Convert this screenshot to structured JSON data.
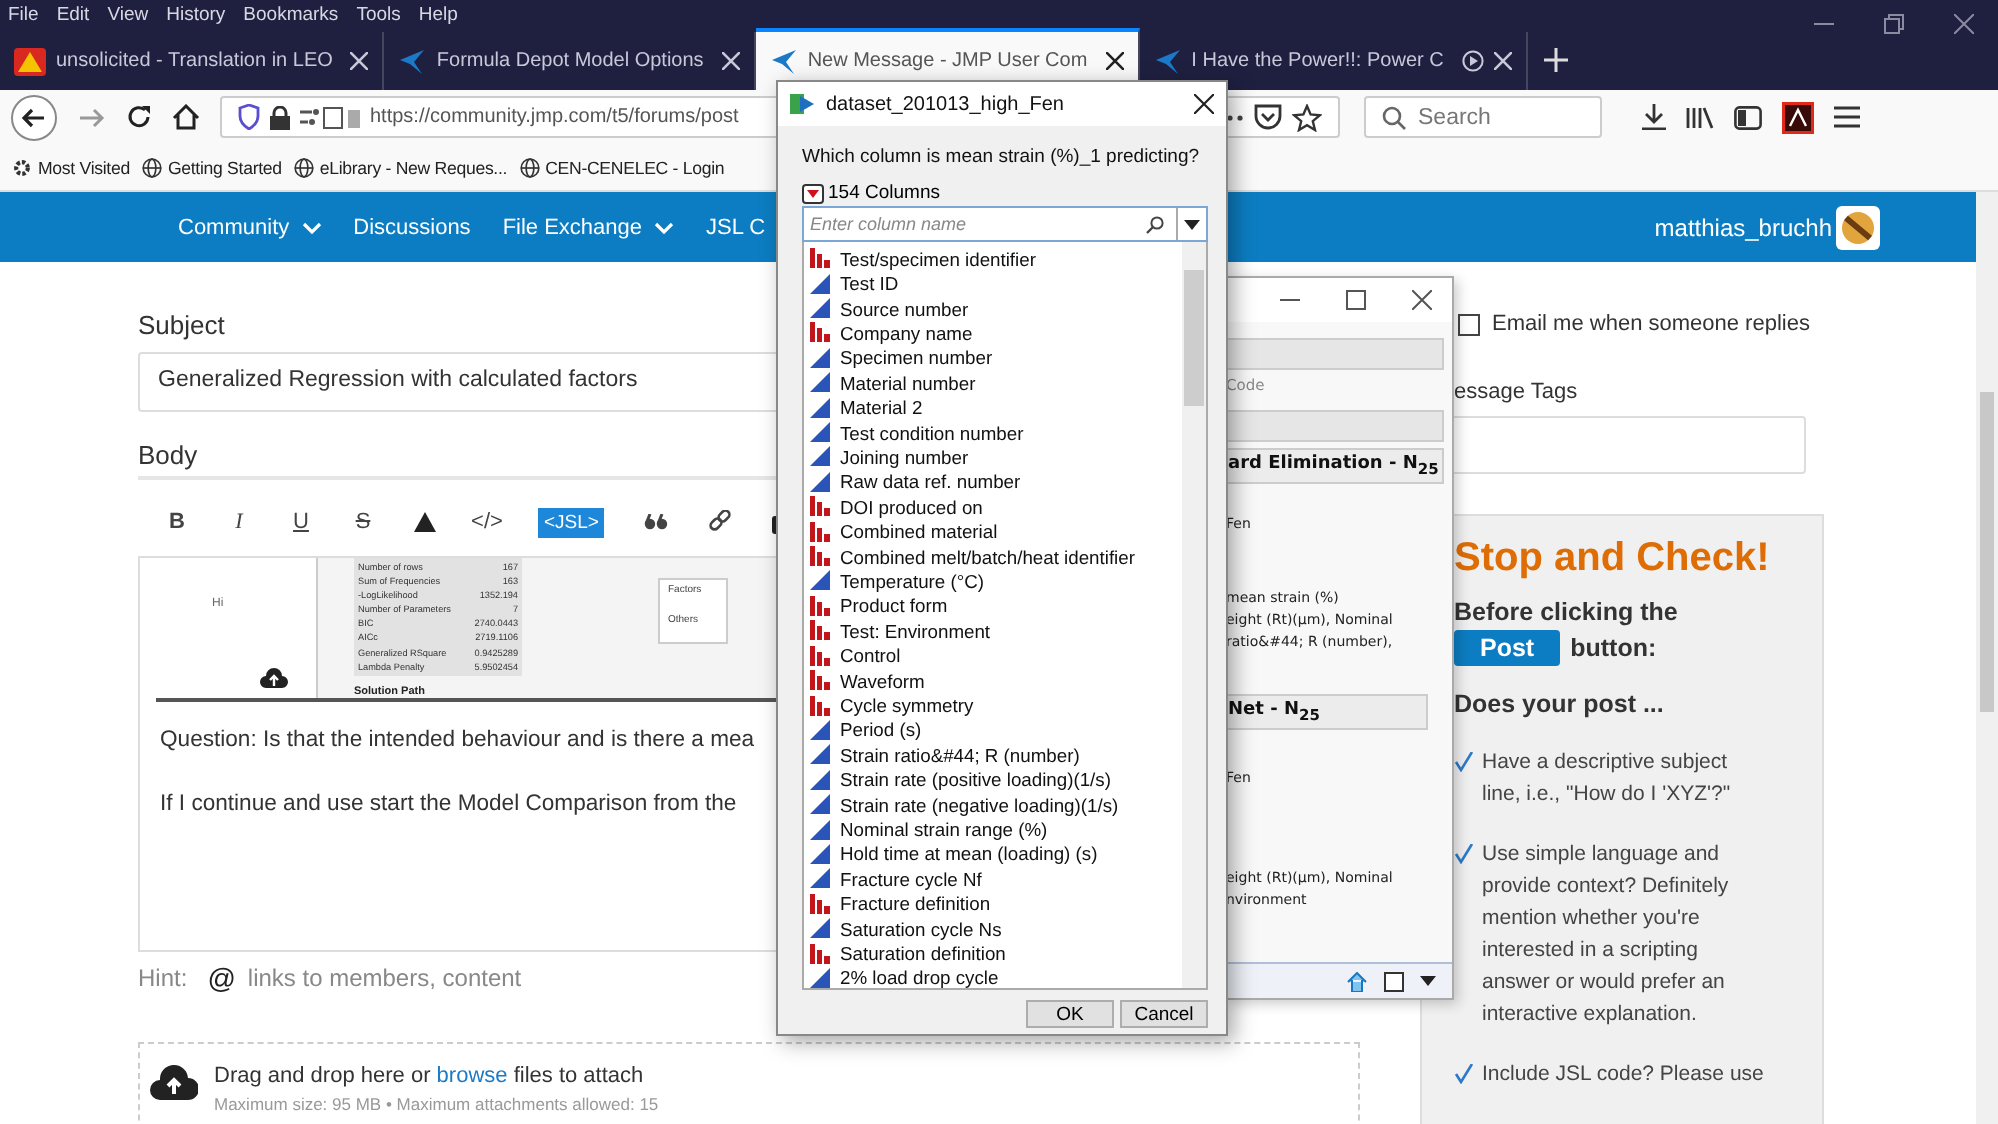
{
  "menu_bar": [
    "File",
    "Edit",
    "View",
    "History",
    "Bookmarks",
    "Tools",
    "Help"
  ],
  "tabs": [
    {
      "title": "unsolicited - Translation in LEO",
      "selected": false,
      "kind": "leo",
      "playing": false
    },
    {
      "title": "Formula Depot Model Options",
      "selected": false,
      "kind": "jmp",
      "playing": false
    },
    {
      "title": "New Message - JMP User Com",
      "selected": true,
      "kind": "jmp",
      "playing": false
    },
    {
      "title": "I Have the Power!!: Power C",
      "selected": false,
      "kind": "jmp",
      "playing": true
    }
  ],
  "address_bar": {
    "url": "https://community.jmp.com/t5/forums/post"
  },
  "search": {
    "placeholder": "Search"
  },
  "bookmarks": [
    "Most Visited",
    "Getting Started",
    "eLibrary - New Reques...",
    "CEN-CENELEC - Login"
  ],
  "site_nav": {
    "items": [
      {
        "label": "Community",
        "dropdown": true
      },
      {
        "label": "Discussions",
        "dropdown": false
      },
      {
        "label": "File Exchange",
        "dropdown": true
      },
      {
        "label": "JSL C",
        "dropdown": false
      }
    ],
    "user": "matthias_bruchh"
  },
  "form": {
    "subject_label": "Subject",
    "subject": "Generalized Regression with calculated factors",
    "body_label": "Body",
    "toolbar": [
      {
        "kind": "text",
        "label": "B"
      },
      {
        "kind": "text",
        "label": "I"
      },
      {
        "kind": "text",
        "label": "U"
      },
      {
        "kind": "text",
        "label": "S"
      },
      {
        "kind": "warning"
      },
      {
        "kind": "text",
        "label": "</>"
      },
      {
        "kind": "jsl",
        "label": "<JSL>"
      },
      {
        "kind": "quote"
      },
      {
        "kind": "link"
      },
      {
        "kind": "camera"
      }
    ],
    "embedded_image": {
      "side_text": "Hi",
      "stats": [
        {
          "name": "Number of rows",
          "value": "167"
        },
        {
          "name": "Sum of Frequencies",
          "value": "163"
        },
        {
          "name": "-LogLikelihood",
          "value": "1352.194"
        },
        {
          "name": "Number of Parameters",
          "value": "7"
        },
        {
          "name": "BIC",
          "value": "2740.0443"
        },
        {
          "name": "AICc",
          "value": "2719.1106"
        },
        {
          "name": "Generalized RSquare",
          "value": "0.9425289"
        },
        {
          "name": "Lambda Penalty",
          "value": "5.9502454"
        }
      ],
      "section": "Solution Path",
      "labels": [
        "Factors",
        "Others"
      ]
    },
    "body_lines": [
      "Question: Is that the intended behaviour and is there a mea",
      "If I continue and use start the Model Comparison from the"
    ],
    "hint": {
      "label": "Hint:",
      "at": "@",
      "text": "links to members, content"
    },
    "attach": {
      "before": "Drag and drop here or ",
      "link": "browse",
      "after": " files to attach",
      "limits": "Maximum size: 95 MB • Maximum attachments allowed: 15"
    }
  },
  "sidebar": {
    "email": {
      "label": "Email me when someone replies",
      "checked": false
    },
    "tags_label": "essage Tags",
    "stop_check": {
      "title": "Stop and Check!",
      "before": "Before clicking the",
      "post_button": "Post",
      "after": "button:",
      "question": "Does your post ...",
      "checks": [
        "Have a descriptive subject line, i.e., \"How do I 'XYZ'?\"",
        "Use simple language and provide context? Definitely mention whether you're interested in a scripting answer or would prefer an interactive explanation.",
        "Include JSL code? Please use"
      ]
    }
  },
  "report_window": {
    "code_label": "Code",
    "header_1": "ard Elimination - N$_{25}$",
    "lines_1": [
      "Fen",
      " mean strain (%)",
      "eight (Rt)(µm), Nominal",
      "ratio&#44; R (number),"
    ],
    "header_2": "Net - N$_{25}$",
    "lines_2": [
      "Fen",
      "eight (Rt)(µm), Nominal",
      "nvironment"
    ],
    "footer_checked": false
  },
  "dialog": {
    "title": "dataset_201013_high_Fen",
    "question": "Which column is mean strain (%)_1 predicting?",
    "count": "154 Columns",
    "search_placeholder": "Enter column name",
    "columns": [
      {
        "name": "Test/specimen identifier",
        "kind": "nominal"
      },
      {
        "name": "Test ID",
        "kind": "continuous"
      },
      {
        "name": "Source number",
        "kind": "continuous"
      },
      {
        "name": "Company name",
        "kind": "nominal"
      },
      {
        "name": "Specimen number",
        "kind": "continuous"
      },
      {
        "name": "Material number",
        "kind": "continuous"
      },
      {
        "name": "Material 2",
        "kind": "continuous"
      },
      {
        "name": "Test condition number",
        "kind": "continuous"
      },
      {
        "name": "Joining number",
        "kind": "continuous"
      },
      {
        "name": "Raw data ref. number",
        "kind": "continuous"
      },
      {
        "name": "DOI produced on",
        "kind": "nominal"
      },
      {
        "name": "Combined material",
        "kind": "nominal"
      },
      {
        "name": "Combined melt/batch/heat identifier",
        "kind": "nominal"
      },
      {
        "name": "Temperature (°C)",
        "kind": "continuous"
      },
      {
        "name": "Product form",
        "kind": "nominal"
      },
      {
        "name": "Test: Environment",
        "kind": "nominal"
      },
      {
        "name": "Control",
        "kind": "nominal"
      },
      {
        "name": "Waveform",
        "kind": "nominal"
      },
      {
        "name": "Cycle symmetry",
        "kind": "nominal"
      },
      {
        "name": "Period (s)",
        "kind": "continuous"
      },
      {
        "name": "Strain ratio&#44; R (number)",
        "kind": "continuous"
      },
      {
        "name": "Strain rate (positive loading)(1/s)",
        "kind": "continuous"
      },
      {
        "name": "Strain rate (negative loading)(1/s)",
        "kind": "continuous"
      },
      {
        "name": "Nominal strain range (%)",
        "kind": "continuous"
      },
      {
        "name": "Hold time at mean (loading) (s)",
        "kind": "continuous"
      },
      {
        "name": "Fracture cycle Nf",
        "kind": "continuous"
      },
      {
        "name": "Fracture definition",
        "kind": "nominal"
      },
      {
        "name": "Saturation cycle Ns",
        "kind": "continuous"
      },
      {
        "name": "Saturation definition",
        "kind": "nominal"
      },
      {
        "name": "2% load drop cycle",
        "kind": "continuous"
      }
    ],
    "buttons": [
      "OK",
      "Cancel"
    ]
  }
}
